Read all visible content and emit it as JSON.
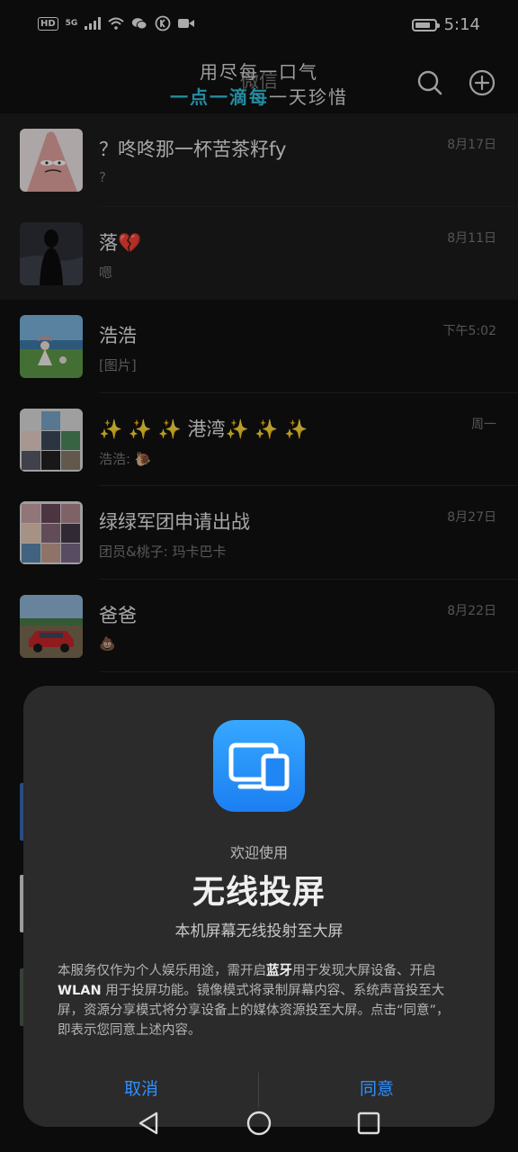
{
  "status_bar": {
    "network_badge": "HD",
    "signal_label": "5G",
    "time": "5:14",
    "icons": [
      "hd-icon",
      "signal-icon",
      "wifi-icon",
      "wechat-icon",
      "k-icon",
      "video-icon",
      "battery-icon"
    ]
  },
  "header": {
    "app_title": "微信",
    "decor_line1": "用尽每一口气",
    "decor_line2_accent": "一点一滴每",
    "decor_line2_rest": "一天珍惜",
    "icons": [
      "search-icon",
      "plus-icon"
    ]
  },
  "chats": [
    {
      "name": "？咚咚那一杯苦茶籽fy",
      "preview": "?",
      "time": "8月17日",
      "pinned": true
    },
    {
      "name": "落💔",
      "preview": "嗯",
      "time": "8月11日",
      "pinned": true
    },
    {
      "name": "浩浩",
      "preview": "[图片]",
      "time": "下午5:02",
      "pinned": false
    },
    {
      "name": "✨ ✨ ✨ 港湾✨ ✨ ✨",
      "preview": "浩浩: 🐌",
      "time": "周一",
      "pinned": false
    },
    {
      "name": "绿绿军团申请出战",
      "preview": "团员&桃子: 玛卡巴卡",
      "time": "8月27日",
      "pinned": false
    },
    {
      "name": "爸爸",
      "preview": "💩",
      "time": "8月22日",
      "pinned": false
    }
  ],
  "dialog": {
    "welcome": "欢迎使用",
    "title": "无线投屏",
    "subtitle": "本机屏幕无线投射至大屏",
    "body_part1": "本服务仅作为个人娱乐用途，需开启",
    "body_bold1": "蓝牙",
    "body_part2": "用于发现大屏设备、开启 ",
    "body_bold2": "WLAN",
    "body_part3": " 用于投屏功能。镜像模式将录制屏幕内容、系统声音投至大屏，资源分享模式将分享设备上的媒体资源投至大屏。点击“同意”，即表示您同意上述内容。",
    "cancel_label": "取消",
    "agree_label": "同意",
    "icon": "screen-cast-icon",
    "icon_color": "#2a8ef8"
  },
  "nav": {
    "icons": [
      "back-icon",
      "home-icon",
      "recent-apps-icon"
    ]
  },
  "colors": {
    "background": "#111111",
    "pinned_row": "#1d1d1d",
    "dialog": "#2b2b2b",
    "accent_button": "#2f8fff",
    "decor_accent": "#32c3e0"
  }
}
